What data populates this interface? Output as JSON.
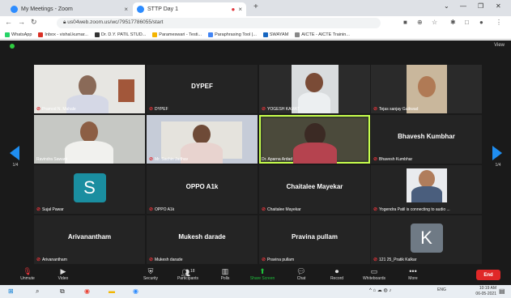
{
  "browser": {
    "tabs": [
      {
        "title": "My Meetings - Zoom",
        "close": "×"
      },
      {
        "title": "STTP Day 1",
        "close": "×"
      }
    ],
    "new_tab": "+",
    "url": "us04web.zoom.us/wc/79517786055/start",
    "bookmarks": [
      "WhatsApp",
      "Inbox - vishal.kumar...",
      "Dr. D.Y. PATIL STUD...",
      "Parameswari - Testi...",
      "Paraphrasing Tool |...",
      "SWAYAM",
      "AICTE - AICTE Trainin..."
    ]
  },
  "zoom": {
    "view_label": "View",
    "page_left": "1/4",
    "page_right": "1/4",
    "tiles": [
      {
        "name": "Pramod N. Mahale",
        "big": "",
        "avatar": ""
      },
      {
        "name": "DYPEF",
        "big": "DYPEF",
        "avatar": ""
      },
      {
        "name": "YOGESH KAMAT",
        "big": "",
        "avatar": ""
      },
      {
        "name": "Tejas sanjay Gaikwad",
        "big": "",
        "avatar": ""
      },
      {
        "name": "Ravindra Sawant",
        "big": "",
        "avatar": ""
      },
      {
        "name": "Mr. Sachin Jadhav",
        "big": "",
        "avatar": ""
      },
      {
        "name": "Dr. Aparna Ardad",
        "big": "",
        "avatar": ""
      },
      {
        "name": "Bhavesh Kumbhar",
        "big": "Bhavesh Kumbhar",
        "avatar": ""
      },
      {
        "name": "Sujal Pawar",
        "big": "",
        "avatar": "S"
      },
      {
        "name": "OPPO A1k",
        "big": "OPPO A1k",
        "avatar": ""
      },
      {
        "name": "Chaitalee Mayekar",
        "big": "Chaitalee Mayekar",
        "avatar": ""
      },
      {
        "name": "Yogendra Patil is connecting to audio ...",
        "big": "",
        "avatar": ""
      },
      {
        "name": "Arivanantham",
        "big": "Arivanantham",
        "avatar": ""
      },
      {
        "name": "Mukesh darade",
        "big": "Mukesh darade",
        "avatar": ""
      },
      {
        "name": "Pravina pullam",
        "big": "Pravina pullam",
        "avatar": ""
      },
      {
        "name": "121 25_Pratik Kalkar",
        "big": "",
        "avatar": "K"
      }
    ],
    "toolbar": [
      "Unmute",
      "Video",
      "Security",
      "Participants",
      "Polls",
      "Share Screen",
      "Chat",
      "Record",
      "Whiteboards",
      "More"
    ],
    "participants_count": "18",
    "end_label": "End"
  },
  "taskbar": {
    "lang": "ENG",
    "time": "10:19 AM",
    "date": "06-05-2021"
  },
  "colors": {
    "zoom_bg": "#1a1a1a",
    "tile_bg": "#242424",
    "active_border": "#c7ff4c",
    "end_red": "#e02828",
    "arrow_blue": "#1f8ef1",
    "avatar_teal": "#1a8ea0",
    "avatar_gray": "#6f7a85"
  }
}
